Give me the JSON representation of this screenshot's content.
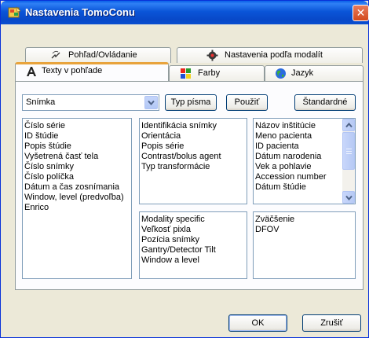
{
  "window": {
    "title": "Nastavenia TomoConu",
    "close_symbol": "✕"
  },
  "tabs": {
    "row1": [
      {
        "label": "Pohľad/Ovládanie",
        "icon": "camera-icon"
      },
      {
        "label": "Nastavenia podľa modalít",
        "icon": "gear-icon"
      }
    ],
    "row2": [
      {
        "label": "Texty v pohľade",
        "icon": "text-font-icon",
        "active": true
      },
      {
        "label": "Farby",
        "icon": "color-palette-icon"
      },
      {
        "label": "Jazyk",
        "icon": "globe-icon"
      }
    ]
  },
  "toolbar": {
    "view_select": "Snímka",
    "font_button": "Typ písma",
    "apply_button": "Použiť",
    "default_button": "Štandardné"
  },
  "lists": {
    "left": [
      "Číslo série",
      "ID štúdie",
      "Popis štúdie",
      "Vyšetrená časť tela",
      "Číslo snímky",
      "Číslo políčka",
      "Dátum a čas zosnímania",
      "Window, level (predvoľba)",
      "Enrico"
    ],
    "top_middle": [
      "Identifikácia snímky",
      "Orientácia",
      "Popis série",
      "Contrast/bolus agent",
      "Typ transformácie"
    ],
    "top_right": [
      "Názov inštitúcie",
      "Meno pacienta",
      "ID pacienta",
      "Dátum narodenia",
      "Vek a pohlavie",
      "Accession number",
      "Dátum štúdie"
    ],
    "bottom_middle": [
      "Modality specific",
      "Veľkosť pixla",
      "Pozícia snímky",
      "Gantry/Detector Tilt",
      "Window a level"
    ],
    "bottom_right": [
      "Zväčšenie",
      "DFOV"
    ]
  },
  "footer": {
    "ok_button": "OK",
    "cancel_button": "Zrušiť"
  },
  "colors": {
    "titlebar": "#0a55d8",
    "active_tab_accent": "#e8a33c",
    "dialog_bg": "#ece9d8"
  }
}
